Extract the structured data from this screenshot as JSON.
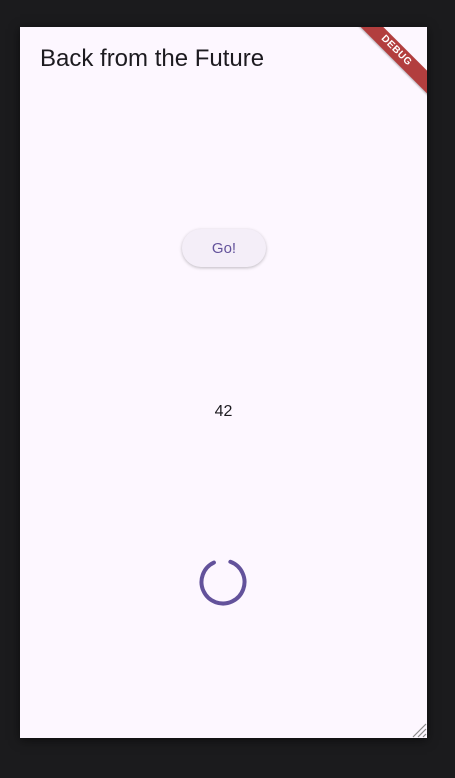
{
  "app": {
    "title": "Back from the Future",
    "debug_banner": "DEBUG"
  },
  "main": {
    "go_button_label": "Go!",
    "result_value": "42",
    "loading_indicator": "circular-progress-icon"
  },
  "colors": {
    "background": "#fdf7ff",
    "accent": "#63529b",
    "debug_banner": "#b23e3e"
  }
}
